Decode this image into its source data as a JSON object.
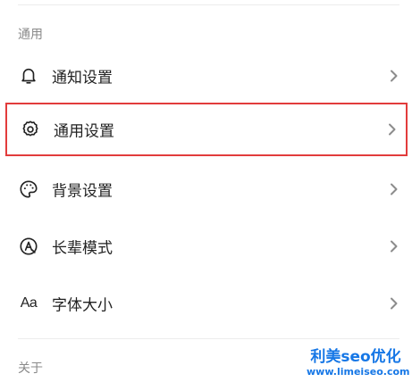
{
  "sections": {
    "general_label": "通用",
    "about_label": "关于"
  },
  "rows": [
    {
      "id": "notify",
      "label": "通知设置",
      "icon": "bell-icon"
    },
    {
      "id": "general-settings",
      "label": "通用设置",
      "icon": "gear-icon",
      "highlighted": true
    },
    {
      "id": "background",
      "label": "背景设置",
      "icon": "palette-icon"
    },
    {
      "id": "elder",
      "label": "长辈模式",
      "icon": "elder-mode-icon"
    },
    {
      "id": "fontsize",
      "label": "字体大小",
      "icon": "font-size-icon",
      "icon_text": "Aa"
    }
  ],
  "watermark": {
    "title": "利美seo优化",
    "url": "www.limeiseo.com"
  },
  "colors": {
    "highlight_border": "#e23c3c",
    "watermark": "#1677e6",
    "chevron": "#8c8c8c",
    "section_label": "#8a8a8a"
  }
}
